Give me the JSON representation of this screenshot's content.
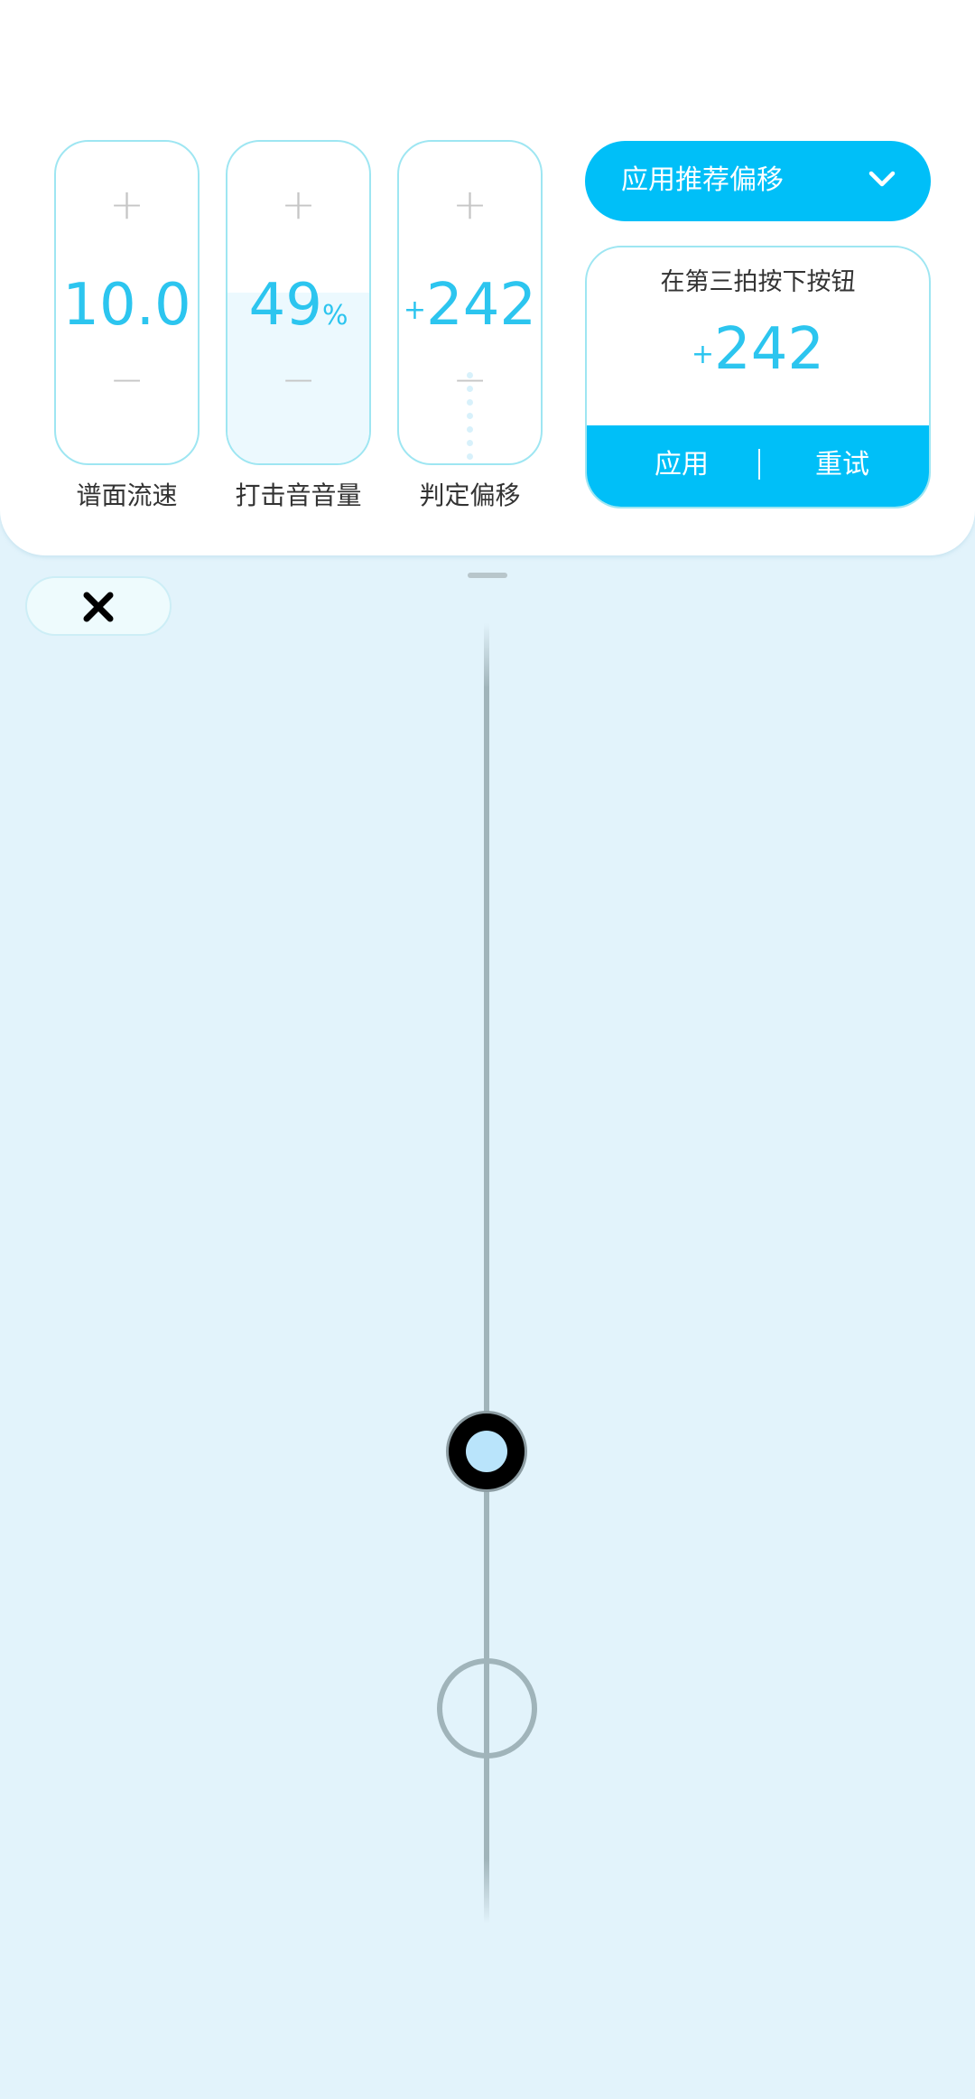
{
  "cards": [
    {
      "label": "谱面流速",
      "value": "10.0",
      "unit": "",
      "sign": "",
      "plus": "+",
      "minus": "−"
    },
    {
      "label": "打击音音量",
      "value": "49",
      "unit": "%",
      "sign": "",
      "plus": "+",
      "minus": "−",
      "level": 0.49
    },
    {
      "label": "判定偏移",
      "value": "242",
      "unit": "",
      "sign": "+",
      "plus": "+",
      "minus": "−"
    }
  ],
  "dropdown": {
    "label": "应用推荐偏移",
    "icon": "chevron-down-icon"
  },
  "offset_box": {
    "title": "在第三拍按下按钮",
    "sign": "+",
    "value": "242",
    "apply_label": "应用",
    "separator": "|",
    "retry_label": "重试"
  },
  "close_button": {
    "icon": "close-icon"
  },
  "colors": {
    "accent": "#00bff8",
    "value_text": "#2cc5ef",
    "card_border": "#9ee6f2",
    "background": "#e2f3fb",
    "track": "#a0b4ba"
  }
}
